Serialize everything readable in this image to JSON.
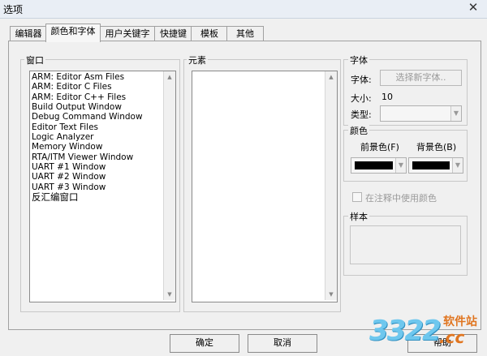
{
  "window": {
    "title": "选项",
    "close_glyph": "✕"
  },
  "tabs": [
    {
      "label": "编辑器",
      "active": false
    },
    {
      "label": "颜色和字体",
      "active": true
    },
    {
      "label": "用户关键字",
      "active": false
    },
    {
      "label": "快捷键",
      "active": false
    },
    {
      "label": "模板",
      "active": false
    },
    {
      "label": "其他",
      "active": false
    }
  ],
  "window_group": {
    "label": "窗口",
    "items": [
      "ARM: Editor Asm Files",
      "ARM: Editor C Files",
      "ARM: Editor C++ Files",
      "Build Output Window",
      "Debug Command Window",
      "Editor Text Files",
      "Logic Analyzer",
      "Memory Window",
      "RTA/ITM Viewer Window",
      "UART #1 Window",
      "UART #2 Window",
      "UART #3 Window",
      "反汇编窗口"
    ]
  },
  "elements_group": {
    "label": "元素",
    "items": []
  },
  "font_group": {
    "label": "字体",
    "font_label": "字体:",
    "choose_font_button": "选择新字体..",
    "size_label": "大小:",
    "size_value": "10",
    "type_label": "类型:",
    "type_value": ""
  },
  "color_group": {
    "label": "颜色",
    "foreground_label": "前景色(F)",
    "background_label": "背景色(B)",
    "foreground_color": "#000000",
    "background_color": "#000000"
  },
  "use_color_in_comments": {
    "label": "在注释中使用颜色",
    "checked": false
  },
  "sample_group": {
    "label": "样本"
  },
  "footer": {
    "ok_label": "确定",
    "cancel_label": "取消",
    "help_label": "帮助"
  },
  "watermark": {
    "digits": "3322",
    "text": "软件站",
    "domain": ".cc"
  },
  "icons": {
    "scroll_up": "triangle-up",
    "scroll_down": "triangle-down",
    "dropdown": "chevron-down"
  }
}
